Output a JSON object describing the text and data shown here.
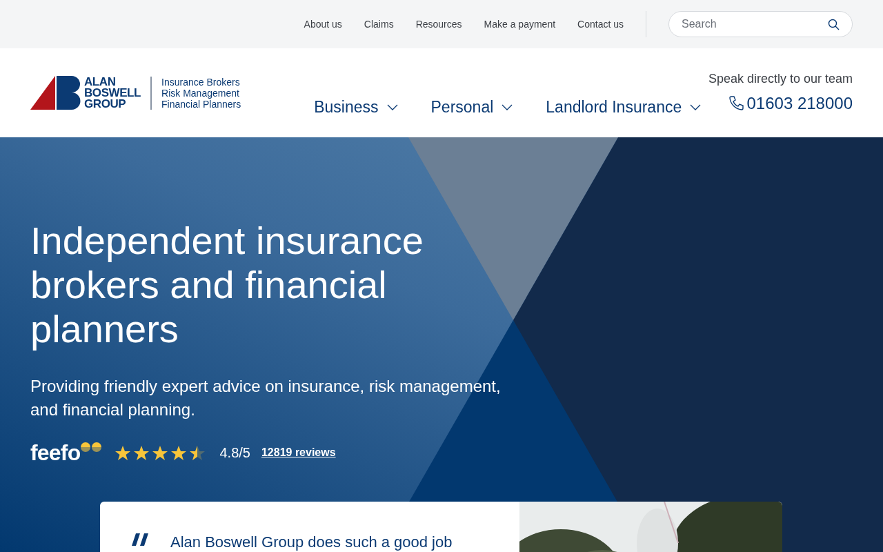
{
  "top_nav": {
    "links": [
      "About us",
      "Claims",
      "Resources",
      "Make a payment",
      "Contact us"
    ],
    "search": {
      "placeholder": "Search"
    }
  },
  "header": {
    "logo": {
      "lines": [
        "ALAN",
        "BOSWELL",
        "GROUP"
      ],
      "tagline": [
        "Insurance Brokers",
        "Risk Management",
        "Financial Planners"
      ]
    },
    "nav": [
      {
        "label": "Business",
        "expanded": false
      },
      {
        "label": "Personal",
        "expanded": false
      },
      {
        "label": "Landlord Insurance",
        "expanded": false
      }
    ],
    "contact": {
      "label": "Speak directly to our team",
      "phone": "01603 218000"
    }
  },
  "hero": {
    "title": "Independent insurance brokers and financial planners",
    "subtitle": "Providing friendly expert advice on insurance, risk management, and financial planning.",
    "rating": {
      "brand": "feefo",
      "stars": 4.5,
      "score": "4.8/5",
      "reviews": "12819 reviews"
    }
  },
  "testimonial": {
    "quote": "Alan Boswell Group does such a good job"
  }
}
